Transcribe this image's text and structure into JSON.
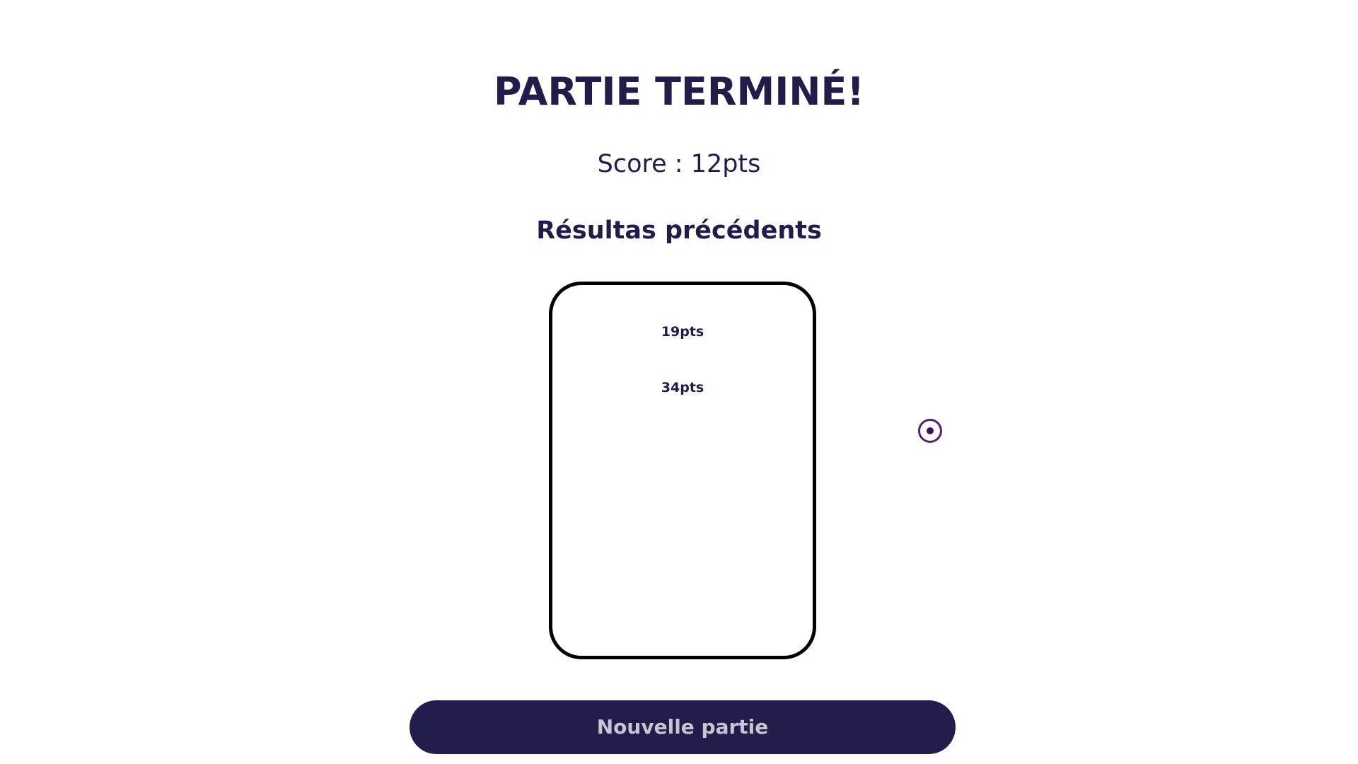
{
  "game_over": {
    "title": "PARTIE TERMINÉ!",
    "score_text": "Score : 12pts"
  },
  "previous_results": {
    "heading": "Résultas précédents",
    "items": [
      "19pts",
      "34pts"
    ]
  },
  "actions": {
    "new_game_label": "Nouvelle partie"
  },
  "colors": {
    "text": "#221c4a",
    "button_bg": "#231d4b",
    "button_text": "#c9c4d4",
    "target_ring": "#5b1e6e"
  },
  "icons": {
    "target": "radio-target-icon"
  }
}
